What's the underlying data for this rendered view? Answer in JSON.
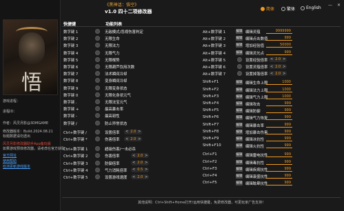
{
  "title": {
    "game_name": "《黑神话：悟空》",
    "version": "v1.0 四十二项修改器"
  },
  "languages": [
    {
      "label": "简体",
      "selected": true
    },
    {
      "label": "繁体",
      "selected": false
    },
    {
      "label": "English",
      "selected": false
    }
  ],
  "window_controls": {
    "minimize": "—",
    "close": "✕"
  },
  "sidebar": {
    "game_process_label": "游戏进程：",
    "process_id_label": "进程ID：",
    "author": "作者：风灵月影@3DMGAME",
    "build": "修改器版本：Build.2024.08.21",
    "tip1": "标题数据请勿透出",
    "promo": "风灵月影修改器助手App备玩版",
    "tip2": "如果游戏预体修改器，请考虑在官方获取",
    "link1": "官方网址",
    "link2": "使用帮助",
    "link3": "检测更新游戏版本"
  },
  "headers": {
    "hotkey_left": "快捷键",
    "function_list": "功能列表"
  },
  "left_rows": [
    {
      "key": "数字键 1",
      "label": "无敌模式/忽视伤害判定"
    },
    {
      "key": "数字键 2",
      "label": "无限生命"
    },
    {
      "key": "数字键 3",
      "label": "无限法力"
    },
    {
      "key": "数字键 4",
      "label": "无限气力"
    },
    {
      "key": "数字键 5",
      "label": "无限棍势"
    },
    {
      "key": "数字键 6",
      "label": "无限葫芦饮用次数"
    },
    {
      "key": "数字键 7",
      "label": "法术瞬间冷却"
    },
    {
      "key": "数字键 8",
      "label": "变身瞬间冷却"
    },
    {
      "key": "数字键 9",
      "label": "无限变身状态"
    },
    {
      "key": "数字键 0",
      "label": "无限化身状元气"
    },
    {
      "key": "数字键 .",
      "label": "无限法宝元气"
    },
    {
      "key": "数字键 +",
      "label": "最高暴击率"
    },
    {
      "key": "数字键 -",
      "label": "最高韧性"
    },
    {
      "key": "数字键 /",
      "label": "防止异常状态"
    }
  ],
  "left_steppers": [
    {
      "key": "Ctrl+数字键 /",
      "label": "设置倍率",
      "value": "2.0"
    },
    {
      "key": "Ctrl+数字键 *",
      "label": "伤害倍率",
      "value": "2.0"
    }
  ],
  "left_rows2": [
    {
      "key": "Ctrl+数字键 1",
      "label": "超级伤害/一击必杀"
    },
    {
      "key": "Ctrl+数字键 2",
      "label": "伤害倍率",
      "value": "2.0"
    },
    {
      "key": "Ctrl+数字键 3",
      "label": "防御倍率",
      "value": "2.0"
    },
    {
      "key": "Ctrl+数字键 4",
      "label": "气力消耗倍率",
      "value": "0.5"
    },
    {
      "key": "Ctrl+数字键 5",
      "label": "设置游戏速度",
      "value": "2.0"
    }
  ],
  "right_rows": [
    {
      "key": "Alt+数字键 1",
      "kind": "edit",
      "label": "编辑灵蕴",
      "value": "9999999"
    },
    {
      "key": "Alt+数字键 2",
      "kind": "edit",
      "label": "编辑点击数值",
      "value": "999"
    },
    {
      "key": "Alt+数字键 3",
      "kind": "edit",
      "label": "增加经验值",
      "value": "50000"
    },
    {
      "key": "Alt+数字键 4",
      "kind": "edit",
      "label": "编辑灵光点",
      "value": "999"
    },
    {
      "key": "Alt+数字键 5",
      "kind": "step",
      "label": "设置经验倍率",
      "value": "2.0"
    },
    {
      "key": "Alt+数字键 6",
      "kind": "step",
      "label": "设置灵蕴倍率",
      "value": "2.0"
    },
    {
      "key": "Alt+数字键 7",
      "kind": "step",
      "label": "设置掉落倍率",
      "value": "2.0"
    },
    {
      "key": "Shift+F1",
      "kind": "edit",
      "label": "编辑生命上限",
      "value": "1000"
    },
    {
      "key": "Shift+F2",
      "kind": "edit",
      "label": "编辑法力上限",
      "value": "1000"
    },
    {
      "key": "Shift+F3",
      "kind": "edit",
      "label": "编辑气力上限",
      "value": "1000"
    },
    {
      "key": "Shift+F4",
      "kind": "edit",
      "label": "编辑攻击",
      "value": "999"
    },
    {
      "key": "Shift+F5",
      "kind": "edit",
      "label": "编辑防御",
      "value": "999"
    },
    {
      "key": "Shift+F6",
      "kind": "edit",
      "label": "编辑气力恢复",
      "value": "999"
    },
    {
      "key": "Shift+F7",
      "kind": "edit",
      "label": "编辑暴击率",
      "value": "999"
    },
    {
      "key": "Shift+F8",
      "kind": "edit",
      "label": "增加暴击伤害",
      "value": "999"
    },
    {
      "key": "Shift+F9",
      "kind": "edit",
      "label": "编辑冰抗性",
      "value": "999"
    },
    {
      "key": "Shift+F10",
      "kind": "edit",
      "label": "编辑火抗性",
      "value": "999"
    },
    {
      "key": "Ctrl+F1",
      "kind": "edit",
      "label": "编辑雷电抗性",
      "value": "999"
    },
    {
      "key": "Ctrl+F2",
      "kind": "edit",
      "label": "编辑毒抗性",
      "value": "999"
    },
    {
      "key": "Ctrl+F3",
      "kind": "edit",
      "label": "编辑疾病抗性",
      "value": "999"
    },
    {
      "key": "Ctrl+F4",
      "kind": "edit",
      "label": "编辑衰盛抗性",
      "value": "999"
    },
    {
      "key": "Ctrl+F5",
      "kind": "edit",
      "label": "编辑眩晕抗性",
      "value": "999"
    }
  ],
  "edit_button_label": "编辑",
  "footer": "其他说明：Ctrl+Shift+Home打开/运用快捷键，免费修改器，可更玩家广告支持！",
  "colors": {
    "accent": "#f29a1e",
    "background": "#1a1a1a"
  }
}
